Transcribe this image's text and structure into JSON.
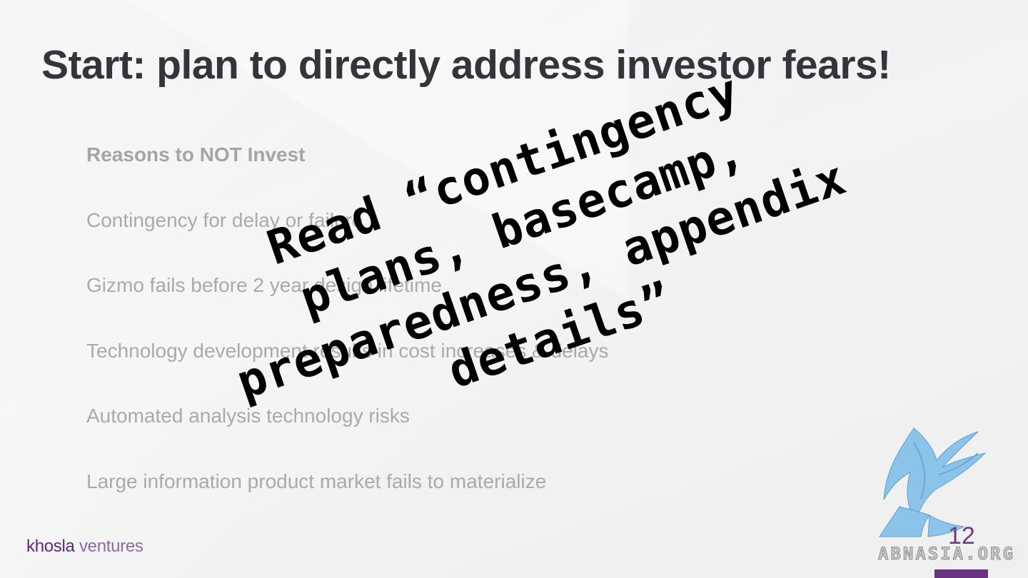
{
  "slide": {
    "title": "Start: plan to directly address investor fears!",
    "list": {
      "heading": "Reasons to NOT Invest",
      "items": [
        "Contingency for delay or failure",
        "Gizmo fails before 2 year design lifetime",
        "Technology development results in cost increases & delays",
        "Automated analysis technology risks",
        "Large information product market fails to materialize"
      ]
    },
    "brand": {
      "part1": "khosla",
      "part2": " ventures"
    },
    "page_number": "12"
  },
  "overlay": {
    "lines": [
      "Read “contingency",
      "plans, basecamp,",
      "preparedness, appendix",
      "details”"
    ]
  },
  "watermark": {
    "text": "ABNASIA.ORG",
    "icon": "griffin-logo-icon"
  },
  "colors": {
    "accent": "#6a3483",
    "title": "#33353a",
    "body_text": "#a8aaae",
    "logo_blue": "#7fb8e0"
  }
}
